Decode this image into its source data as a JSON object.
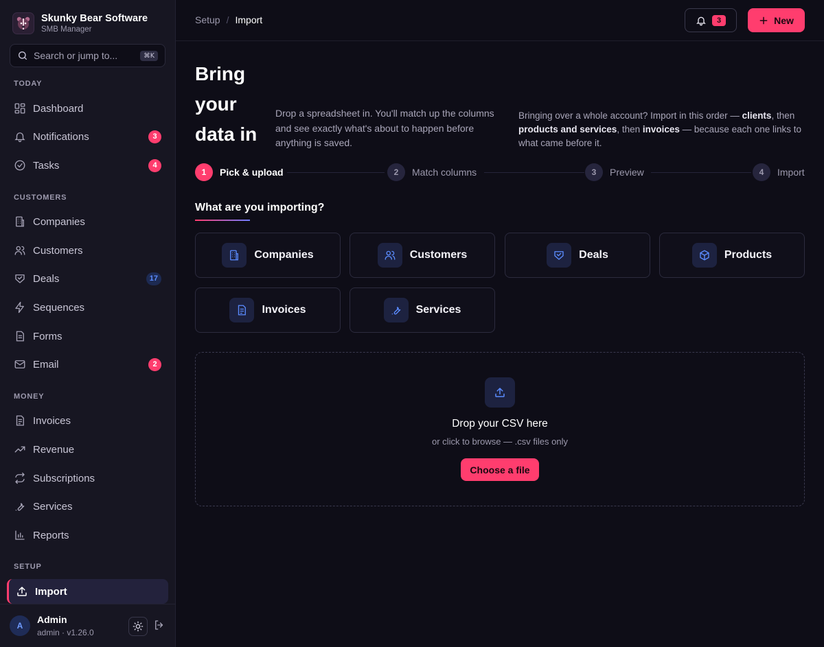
{
  "brand": {
    "name": "Skunky Bear Software",
    "subtitle": "SMB Manager"
  },
  "search": {
    "placeholder": "Search or jump to...",
    "shortcut": "⌘K"
  },
  "sidebar": {
    "sections": [
      "TODAY",
      "CUSTOMERS",
      "MONEY",
      "SETUP"
    ],
    "items": [
      {
        "label": "Dashboard",
        "icon": "dashboard-icon"
      },
      {
        "label": "Notifications",
        "icon": "bell-icon",
        "badge": "3"
      },
      {
        "label": "Tasks",
        "icon": "check-circle-icon",
        "badge": "4"
      },
      {
        "label": "Companies",
        "icon": "building-icon"
      },
      {
        "label": "Customers",
        "icon": "users-icon"
      },
      {
        "label": "Deals",
        "icon": "handshake-icon",
        "badge": "17"
      },
      {
        "label": "Sequences",
        "icon": "lightning-icon"
      },
      {
        "label": "Forms",
        "icon": "document-icon"
      },
      {
        "label": "Email",
        "icon": "mail-icon",
        "badge": "2"
      },
      {
        "label": "Invoices",
        "icon": "invoice-icon"
      },
      {
        "label": "Revenue",
        "icon": "trending-up-icon"
      },
      {
        "label": "Subscriptions",
        "icon": "repeat-icon"
      },
      {
        "label": "Services",
        "icon": "wrench-icon"
      },
      {
        "label": "Reports",
        "icon": "bar-chart-icon"
      },
      {
        "label": "Import",
        "icon": "upload-icon",
        "active": true
      }
    ]
  },
  "user": {
    "initial": "A",
    "name": "Admin",
    "meta": "admin · v1.26.0"
  },
  "topbar": {
    "breadcrumb": {
      "parent": "Setup",
      "separator": "/",
      "current": "Import"
    },
    "notification_count": "3",
    "new_label": "New"
  },
  "hero": {
    "title": "Bring your data in",
    "description": "Drop a spreadsheet in. You'll match up the columns and see exactly what's about to happen before anything is saved.",
    "hint_prefix": "Bringing over a whole account? Import in this order — ",
    "hint_clients": "clients",
    "hint_then1": ", then ",
    "hint_products": "products and services",
    "hint_then2": ", then ",
    "hint_invoices": "invoices",
    "hint_suffix": " — because each one links to what came before it."
  },
  "steps": [
    {
      "num": "1",
      "label": "Pick & upload",
      "active": true
    },
    {
      "num": "2",
      "label": "Match columns"
    },
    {
      "num": "3",
      "label": "Preview"
    },
    {
      "num": "4",
      "label": "Import"
    }
  ],
  "question": "What are you importing?",
  "types": [
    {
      "label": "Companies",
      "icon": "building-icon"
    },
    {
      "label": "Customers",
      "icon": "users-icon"
    },
    {
      "label": "Deals",
      "icon": "handshake-icon"
    },
    {
      "label": "Products",
      "icon": "cube-icon"
    },
    {
      "label": "Invoices",
      "icon": "invoice-icon"
    },
    {
      "label": "Services",
      "icon": "wrench-icon"
    }
  ],
  "dropzone": {
    "title": "Drop your CSV here",
    "subtitle": "or click to browse — .csv files only",
    "button": "Choose a file"
  },
  "colors": {
    "accent": "#ff3d6e",
    "info": "#5b8cff",
    "background": "#0e0d17",
    "sidebar": "#171622"
  }
}
